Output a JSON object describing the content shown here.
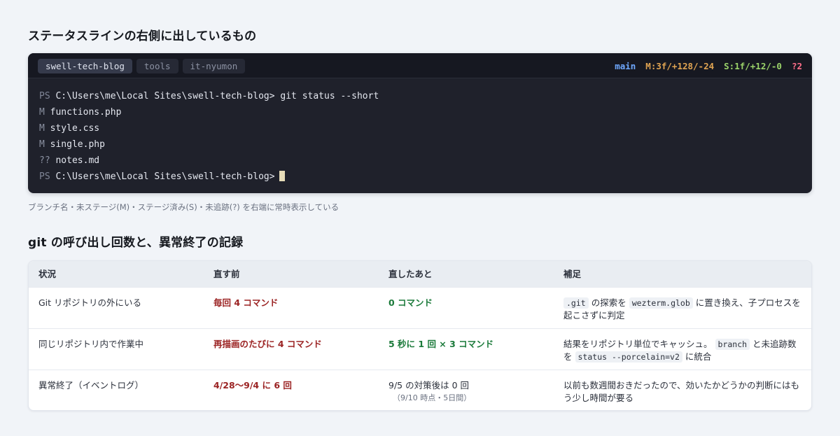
{
  "sections": {
    "statusline_heading": "ステータスラインの右側に出しているもの",
    "table_heading": "git の呼び出し回数と、異常終了の記録"
  },
  "terminal": {
    "tabs": [
      {
        "label": "swell-tech-blog",
        "active": true
      },
      {
        "label": "tools",
        "active": false
      },
      {
        "label": "it-nyumon",
        "active": false
      }
    ],
    "status": {
      "branch": "main",
      "modified": "M:3f/+128/-24",
      "staged": "S:1f/+12/-0",
      "untracked": "?2"
    },
    "lines": {
      "l1_prompt": "PS",
      "l1_path": "C:\\Users\\me\\Local Sites\\swell-tech-blog>",
      "l1_cmd": "git status --short",
      "l2_flag": "M",
      "l2_file": "functions.php",
      "l3_flag": "M",
      "l3_file": "style.css",
      "l4_flag": "M",
      "l4_file": "single.php",
      "l5_flag": "??",
      "l5_file": "notes.md",
      "l6_prompt": "PS",
      "l6_path": "C:\\Users\\me\\Local Sites\\swell-tech-blog>"
    },
    "colors": {
      "background": "#1f212b",
      "branch": "#6fa8ff",
      "modified": "#e0a452",
      "staged": "#9bd36a",
      "untracked": "#ff6f8a"
    }
  },
  "caption": "ブランチ名・未ステージ(M)・ステージ済み(S)・未追跡(?) を右端に常時表示している",
  "table": {
    "headers": [
      "状況",
      "直す前",
      "直したあと",
      "補足"
    ],
    "rows": [
      {
        "situation": "Git リポジトリの外にいる",
        "before": "毎回 4 コマンド",
        "after": "0 コマンド",
        "note_code1": ".git",
        "note_text1": "の探索を",
        "note_code2": "wezterm.glob",
        "note_text2": "に置き換え、子プロセスを起こさずに判定"
      },
      {
        "situation": "同じリポジトリ内で作業中",
        "before": "再描画のたびに 4 コマンド",
        "after": "5 秒に 1 回 × 3 コマンド",
        "note_text1": "結果をリポジトリ単位でキャッシュ。",
        "note_code1": "branch",
        "note_text2": "と未追跡数を",
        "note_code2": "status --porcelain=v2",
        "note_text3": "に統合"
      },
      {
        "situation": "異常終了（イベントログ）",
        "before": "4/28〜9/4 に 6 回",
        "after": "9/5 の対策後は 0 回",
        "after_sub": "（9/10 時点・5日間）",
        "note": "以前も数週間おきだったので、効いたかどうかの判断にはもう少し時間が要る"
      }
    ],
    "colors": {
      "worse": "#9b2323",
      "better": "#1b7a3a"
    }
  }
}
